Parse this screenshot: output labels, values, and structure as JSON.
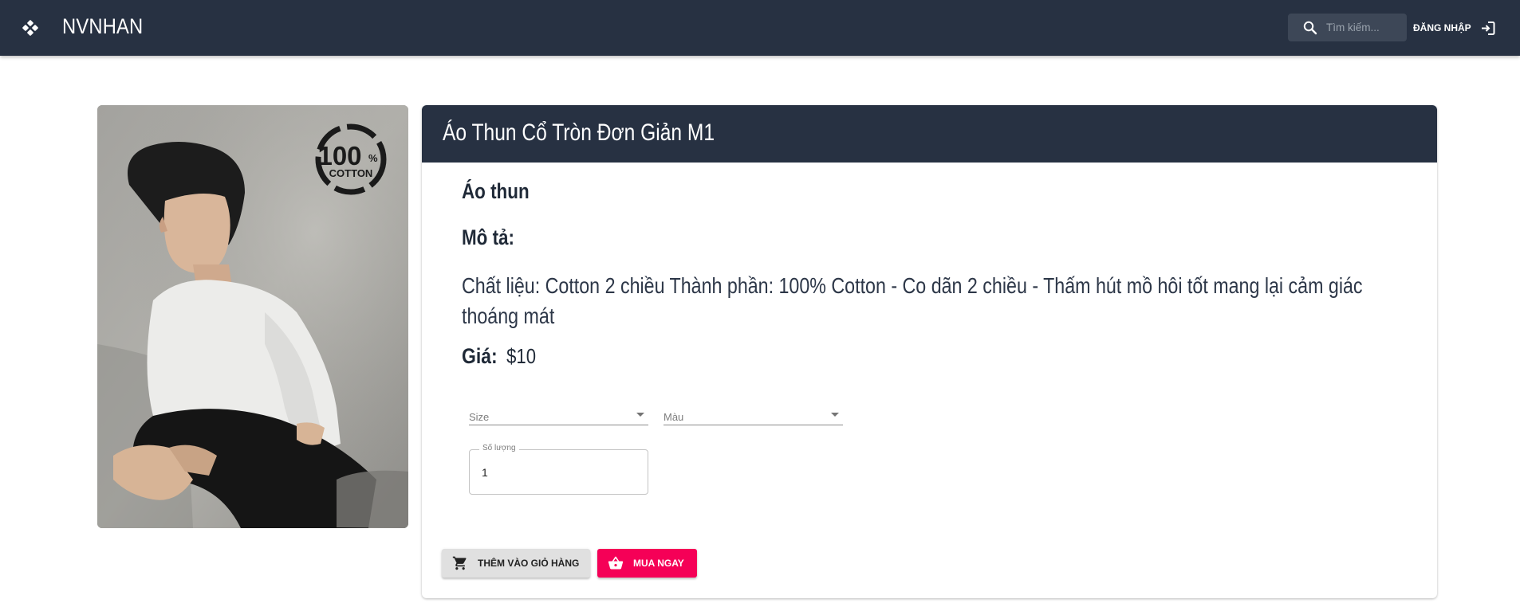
{
  "header": {
    "brand": "NVNHAN",
    "search_placeholder": "Tìm kiếm...",
    "login_label": "ĐĂNG NHẬP"
  },
  "product": {
    "title": "Áo Thun Cổ Tròn Đơn Giản M1",
    "category": "Áo thun",
    "description_label": "Mô tả:",
    "description": "Chất liệu: Cotton 2 chiều Thành phần: 100% Cotton - Co dãn 2 chiều - Thấm hút mồ hôi tốt mang lại cảm giác thoáng mát",
    "price_label": "Giá:",
    "price": "$10",
    "image_badge_number": "100",
    "image_badge_percent": "%",
    "image_badge_text": "COTTON"
  },
  "form": {
    "size_label": "Size",
    "color_label": "Màu",
    "quantity_label": "Số lượng",
    "quantity_value": "1"
  },
  "actions": {
    "add_to_cart_label": "THÊM VÀO GIỎ HÀNG",
    "buy_now_label": "MUA NGAY"
  },
  "icons": [
    "gamepad-icon",
    "search-icon",
    "login-icon",
    "shopping-cart-icon",
    "shopping-basket-icon"
  ],
  "colors": {
    "navbar": "#273142",
    "search_bg": "#3d4757",
    "buy_button": "#f50057",
    "cart_button": "#e0e0e0"
  }
}
